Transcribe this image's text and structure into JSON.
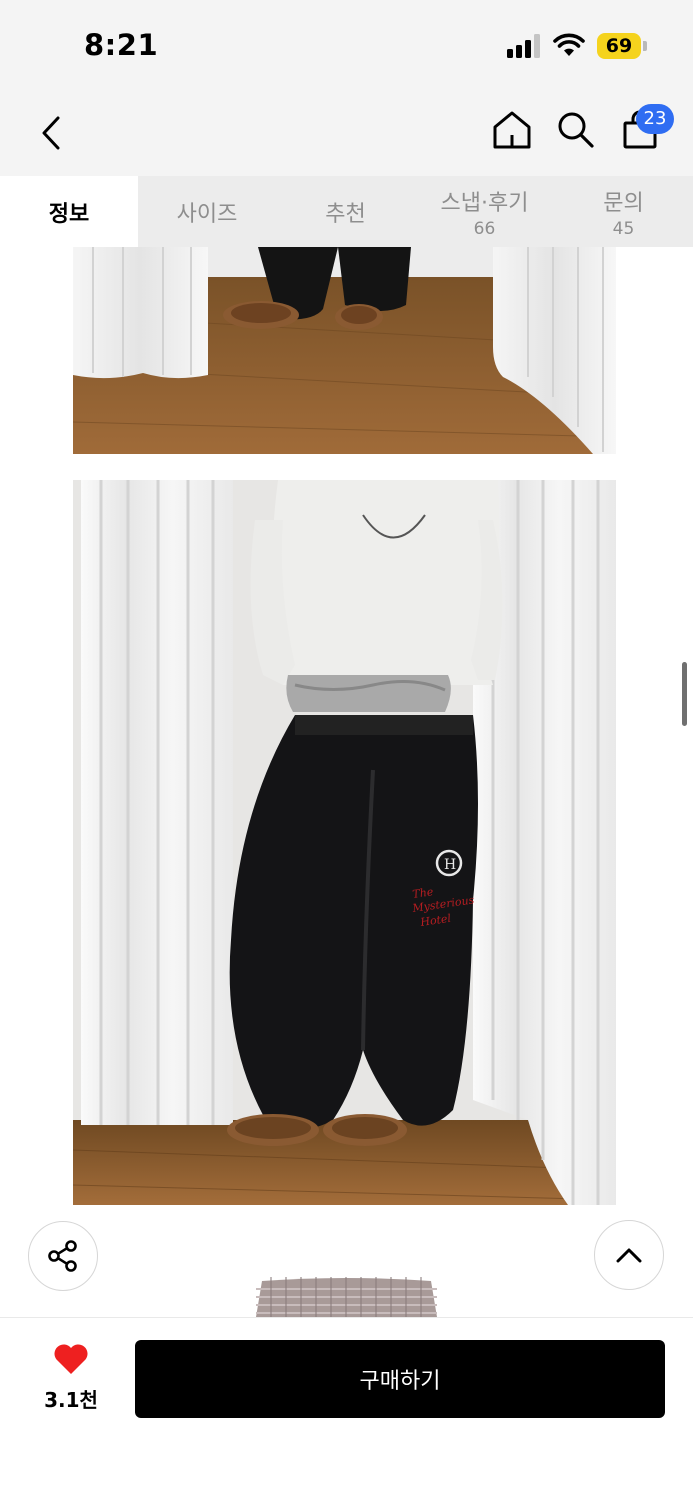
{
  "status_bar": {
    "time": "8:21",
    "battery": "69",
    "battery_color": "#f5d31d",
    "icons": [
      "cellular-signal-icon",
      "wifi-icon",
      "battery-icon"
    ]
  },
  "nav": {
    "icons": [
      "back-arrow-icon",
      "home-icon",
      "search-icon",
      "shopping-bag-icon"
    ],
    "cart_badge": "23",
    "badge_color": "#2f6df2"
  },
  "tabs": [
    {
      "label": "정보",
      "count": "",
      "active": true
    },
    {
      "label": "사이즈",
      "count": "",
      "active": false
    },
    {
      "label": "추천",
      "count": "",
      "active": false
    },
    {
      "label": "스냅·후기",
      "count": "66",
      "active": false
    },
    {
      "label": "문의",
      "count": "45",
      "active": false
    }
  ],
  "floating": {
    "icons": [
      "share-icon",
      "scroll-to-top-icon"
    ]
  },
  "bottom_bar": {
    "like_icon": "heart-icon",
    "like_color": "#ee2020",
    "like_count": "3.1천",
    "buy_label": "구매하기"
  },
  "brand_embroidery": "The Mysterious Hotel"
}
